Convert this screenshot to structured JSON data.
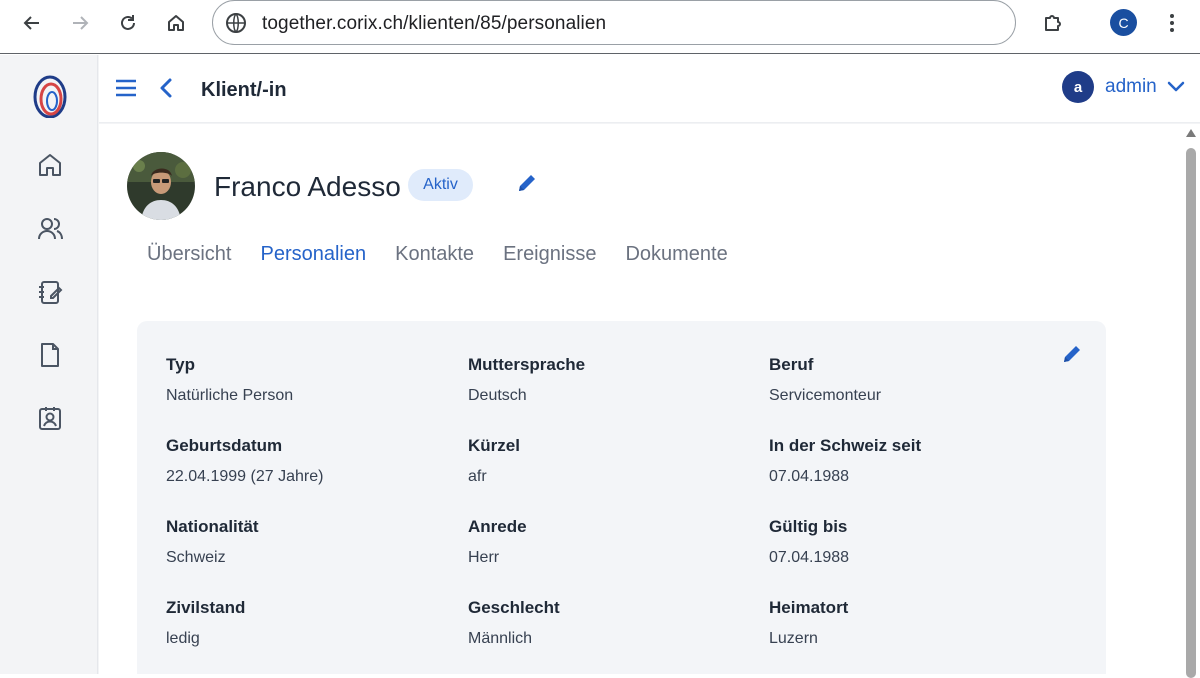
{
  "browser": {
    "url": "together.corix.ch/klienten/85/personalien",
    "profile_initial": "C"
  },
  "header": {
    "title": "Klient/-in",
    "user_initial": "a",
    "user_name": "admin"
  },
  "client": {
    "name": "Franco Adesso",
    "status": "Aktiv"
  },
  "tabs": [
    {
      "label": "Übersicht",
      "active": false
    },
    {
      "label": "Personalien",
      "active": true
    },
    {
      "label": "Kontakte",
      "active": false
    },
    {
      "label": "Ereignisse",
      "active": false
    },
    {
      "label": "Dokumente",
      "active": false
    }
  ],
  "fields": [
    {
      "label": "Typ",
      "value": "Natürliche Person"
    },
    {
      "label": "Muttersprache",
      "value": "Deutsch"
    },
    {
      "label": "Beruf",
      "value": "Servicemonteur"
    },
    {
      "label": "Geburtsdatum",
      "value": "22.04.1999 (27 Jahre)"
    },
    {
      "label": "Kürzel",
      "value": "afr"
    },
    {
      "label": "In der Schweiz seit",
      "value": "07.04.1988"
    },
    {
      "label": "Nationalität",
      "value": "Schweiz"
    },
    {
      "label": "Anrede",
      "value": "Herr"
    },
    {
      "label": "Gültig bis",
      "value": "07.04.1988"
    },
    {
      "label": "Zivilstand",
      "value": "ledig"
    },
    {
      "label": "Geschlecht",
      "value": "Männlich"
    },
    {
      "label": "Heimatort",
      "value": "Luzern"
    }
  ],
  "colors": {
    "accent": "#2563c9",
    "badge_bg": "#e0ebfb",
    "card_bg": "#f3f5f8",
    "sidebar_bg": "#f3f4f6"
  },
  "icons": {
    "sidebar": [
      "home-icon",
      "users-icon",
      "notebook-edit-icon",
      "document-icon",
      "contact-badge-icon"
    ]
  }
}
